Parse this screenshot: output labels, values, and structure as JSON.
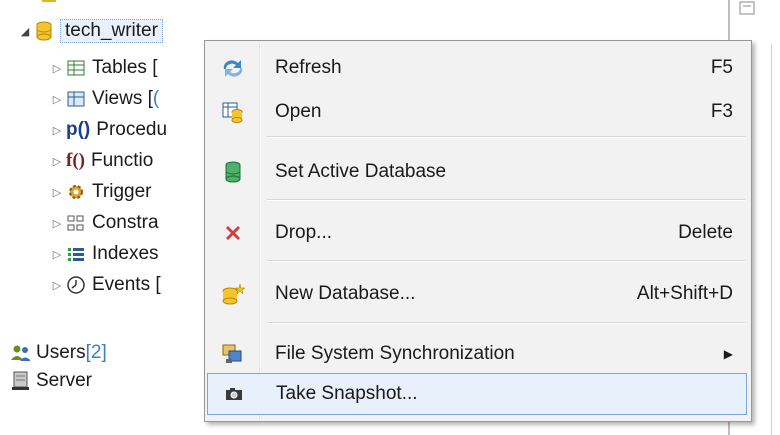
{
  "tree": {
    "db_name": "tech_writer",
    "children": [
      {
        "label": "Tables [",
        "count": ""
      },
      {
        "label": "Views [",
        "count": "("
      },
      {
        "label": "Procedu",
        "count": ""
      },
      {
        "label": "Functio",
        "count": ""
      },
      {
        "label": "Trigger",
        "count": ""
      },
      {
        "label": "Constra",
        "count": ""
      },
      {
        "label": "Indexes",
        "count": ""
      },
      {
        "label": "Events [",
        "count": ""
      }
    ],
    "users": {
      "label": "Users ",
      "count": "[2]"
    },
    "server": {
      "label": "Server"
    }
  },
  "menu": {
    "items": [
      {
        "label": "Refresh",
        "shortcut": "F5",
        "icon": "refresh-icon"
      },
      {
        "label": "Open",
        "shortcut": "F3",
        "icon": "open-table-icon"
      },
      {
        "label": "Set Active Database",
        "shortcut": "",
        "icon": "database-icon"
      },
      {
        "label": "Drop...",
        "shortcut": "Delete",
        "icon": "drop-x-icon"
      },
      {
        "label": "New Database...",
        "shortcut": "Alt+Shift+D",
        "icon": "new-database-icon"
      },
      {
        "label": "File System Synchronization",
        "shortcut": "",
        "icon": "sync-icon",
        "submenu": true
      },
      {
        "label": "Take Snapshot...",
        "shortcut": "",
        "icon": "camera-icon"
      }
    ]
  },
  "colors": {
    "accent": "#3b7fc4",
    "highlight": "#e8f1fb",
    "drop": "#d63a3a"
  }
}
